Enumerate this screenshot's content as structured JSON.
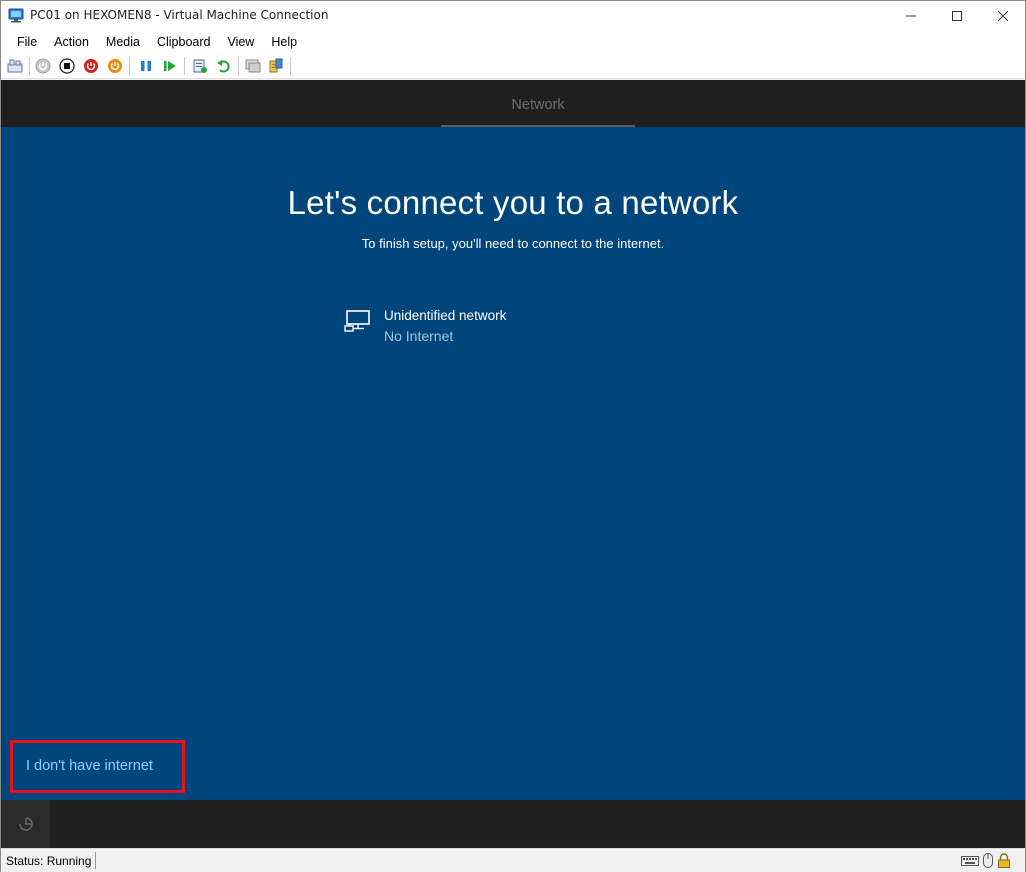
{
  "window": {
    "title": "PC01 on HEXOMEN8 - Virtual Machine Connection",
    "icon": "vm-connection-icon"
  },
  "menu": [
    "File",
    "Action",
    "Media",
    "Clipboard",
    "View",
    "Help"
  ],
  "toolbar": {
    "icons": [
      "ctrl-alt-del-icon",
      "start-icon",
      "turn-off-icon",
      "shut-down-icon",
      "save-state-icon",
      "pause-icon",
      "resume-icon",
      "checkpoint-icon",
      "revert-icon",
      "enhanced-session-icon",
      "share-icon"
    ]
  },
  "vm": {
    "tab": "Network",
    "heading": "Let's connect you to a network",
    "subheading": "To finish setup, you'll need to connect to the internet.",
    "network": {
      "name": "Unidentified network",
      "status": "No Internet"
    },
    "no_internet_link": "I don't have internet",
    "highlight_color": "#e8121e",
    "background_color": "#00457c"
  },
  "status": {
    "text": "Status: Running"
  }
}
